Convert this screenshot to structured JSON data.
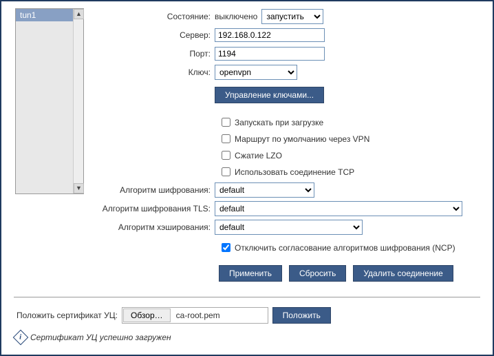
{
  "sidebar": {
    "items": [
      {
        "label": "tun1"
      }
    ]
  },
  "labels": {
    "state": "Состояние:",
    "server": "Сервер:",
    "port": "Порт:",
    "key": "Ключ:",
    "enc_alg": "Алгоритм шифрования:",
    "enc_alg_tls": "Алгоритм шифрования TLS:",
    "hash_alg": "Алгоритм хэширования:",
    "cert_label": "Положить сертификат УЦ:"
  },
  "values": {
    "state_text": "выключено",
    "server": "192.168.0.122",
    "port": "1194",
    "key": "openvpn",
    "action": "запустить",
    "enc_alg": "default",
    "enc_alg_tls": "default",
    "hash_alg": "default",
    "file_name": "ca-root.pem"
  },
  "buttons": {
    "manage_keys": "Управление ключами...",
    "apply": "Применить",
    "reset": "Сбросить",
    "delete": "Удалить соединение",
    "browse": "Обзор…",
    "put": "Положить"
  },
  "checkboxes": {
    "autostart": "Запускать при загрузке",
    "default_route": "Маршрут по умолчанию через VPN",
    "lzo": "Сжатие LZO",
    "tcp": "Использовать соединение TCP",
    "ncp": "Отключить согласование алгоритмов шифрования (NCP)"
  },
  "status": {
    "message": "Сертификат УЦ успешно загружен"
  }
}
